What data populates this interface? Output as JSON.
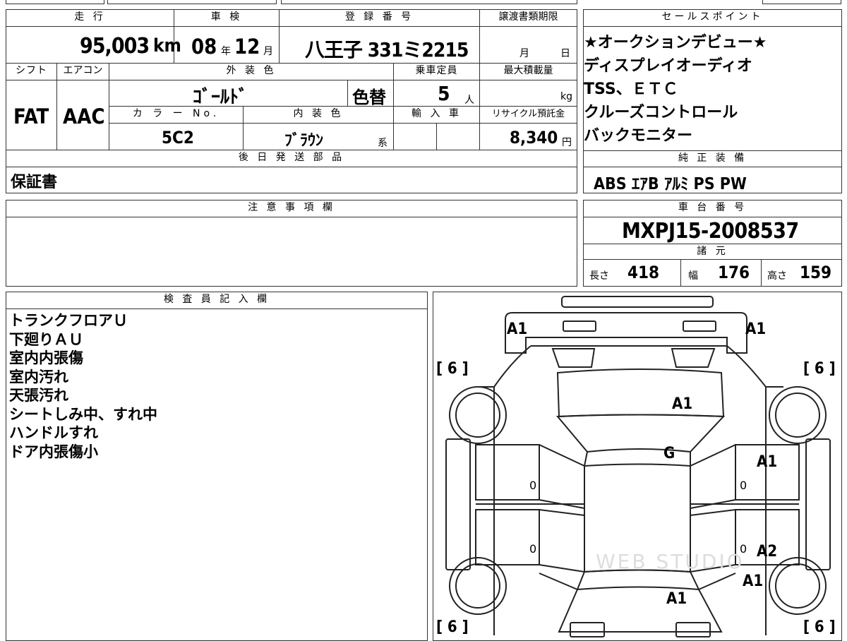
{
  "vehicle": {
    "mileage_label": "走 行",
    "mileage_value": "95,003",
    "mileage_unit": "km",
    "inspection_label": "車 検",
    "inspection_year": "08",
    "inspection_year_unit": "年",
    "inspection_month": "12",
    "inspection_month_unit": "月",
    "registration_label": "登 録 番 号",
    "registration_value": "八王子 331ミ2215",
    "transfer_label": "譲渡書類期限",
    "transfer_month_unit": "月",
    "transfer_day_unit": "日",
    "shift_label": "シフト",
    "shift_value": "FAT",
    "aircon_label": "エアコン",
    "aircon_value": "AAC",
    "exterior_label": "外 装 色",
    "exterior_value": "ｺﾞｰﾙﾄﾞ",
    "repaint_value": "色替",
    "capacity_label": "乗車定員",
    "capacity_value": "5",
    "capacity_unit": "人",
    "maxload_label": "最大積載量",
    "maxload_unit": "kg",
    "color_no_label": "カ ラ ー No.",
    "color_no_value": "5C2",
    "interior_label": "内 装 色",
    "interior_value": "ﾌﾞﾗｳﾝ",
    "interior_suffix": "系",
    "import_label": "輸 入 車",
    "recycle_label": "リサイクル預託金",
    "recycle_value": "8,340",
    "recycle_unit": "円",
    "later_parts_label": "後 日 発 送 部 品",
    "later_parts_value": "保証書"
  },
  "sales_points": {
    "title": "セールスポイント",
    "lines": [
      "★オークションデビュー★",
      "ディスプレイオーディオ",
      "TSS、ＥＴＣ",
      "クルーズコントロール",
      "バックモニター"
    ]
  },
  "equipment": {
    "title": "純 正 装 備",
    "value": "ABS ｴｱB ｱﾙﾐ PS PW"
  },
  "notes": {
    "title": "注 意 事 項 欄"
  },
  "chassis": {
    "title": "車 台 番 号",
    "value": "MXPJ15-2008537"
  },
  "specs": {
    "title": "諸 元",
    "length_label": "長さ",
    "length_value": "418",
    "width_label": "幅",
    "width_value": "176",
    "height_label": "高さ",
    "height_value": "159"
  },
  "inspector": {
    "title": "検 査 員 記 入 欄",
    "lines": [
      "トランクフロアＵ",
      "下廻りＡＵ",
      "室内内張傷",
      "室内汚れ",
      "天張汚れ",
      "シートしみ中、すれ中",
      "ハンドルすれ",
      "ドア内張傷小"
    ]
  },
  "diagram": {
    "marks": {
      "front_left": "A1",
      "front_right": "A1",
      "hood": "A1",
      "windshield": "G",
      "front_door_right": "A1",
      "rear_door_right": "A2",
      "rear_fender_right": "A1",
      "roof_rear": "A1"
    },
    "tire_tl": "[ 6 ]",
    "tire_tr": "[ 6 ]",
    "tire_bl": "[ 6 ]",
    "tire_br": "[ 6 ]",
    "door_zero_1": "0",
    "door_zero_2": "0",
    "door_zero_3": "0",
    "door_zero_4": "0",
    "watermark": "WEB STUDIO"
  }
}
